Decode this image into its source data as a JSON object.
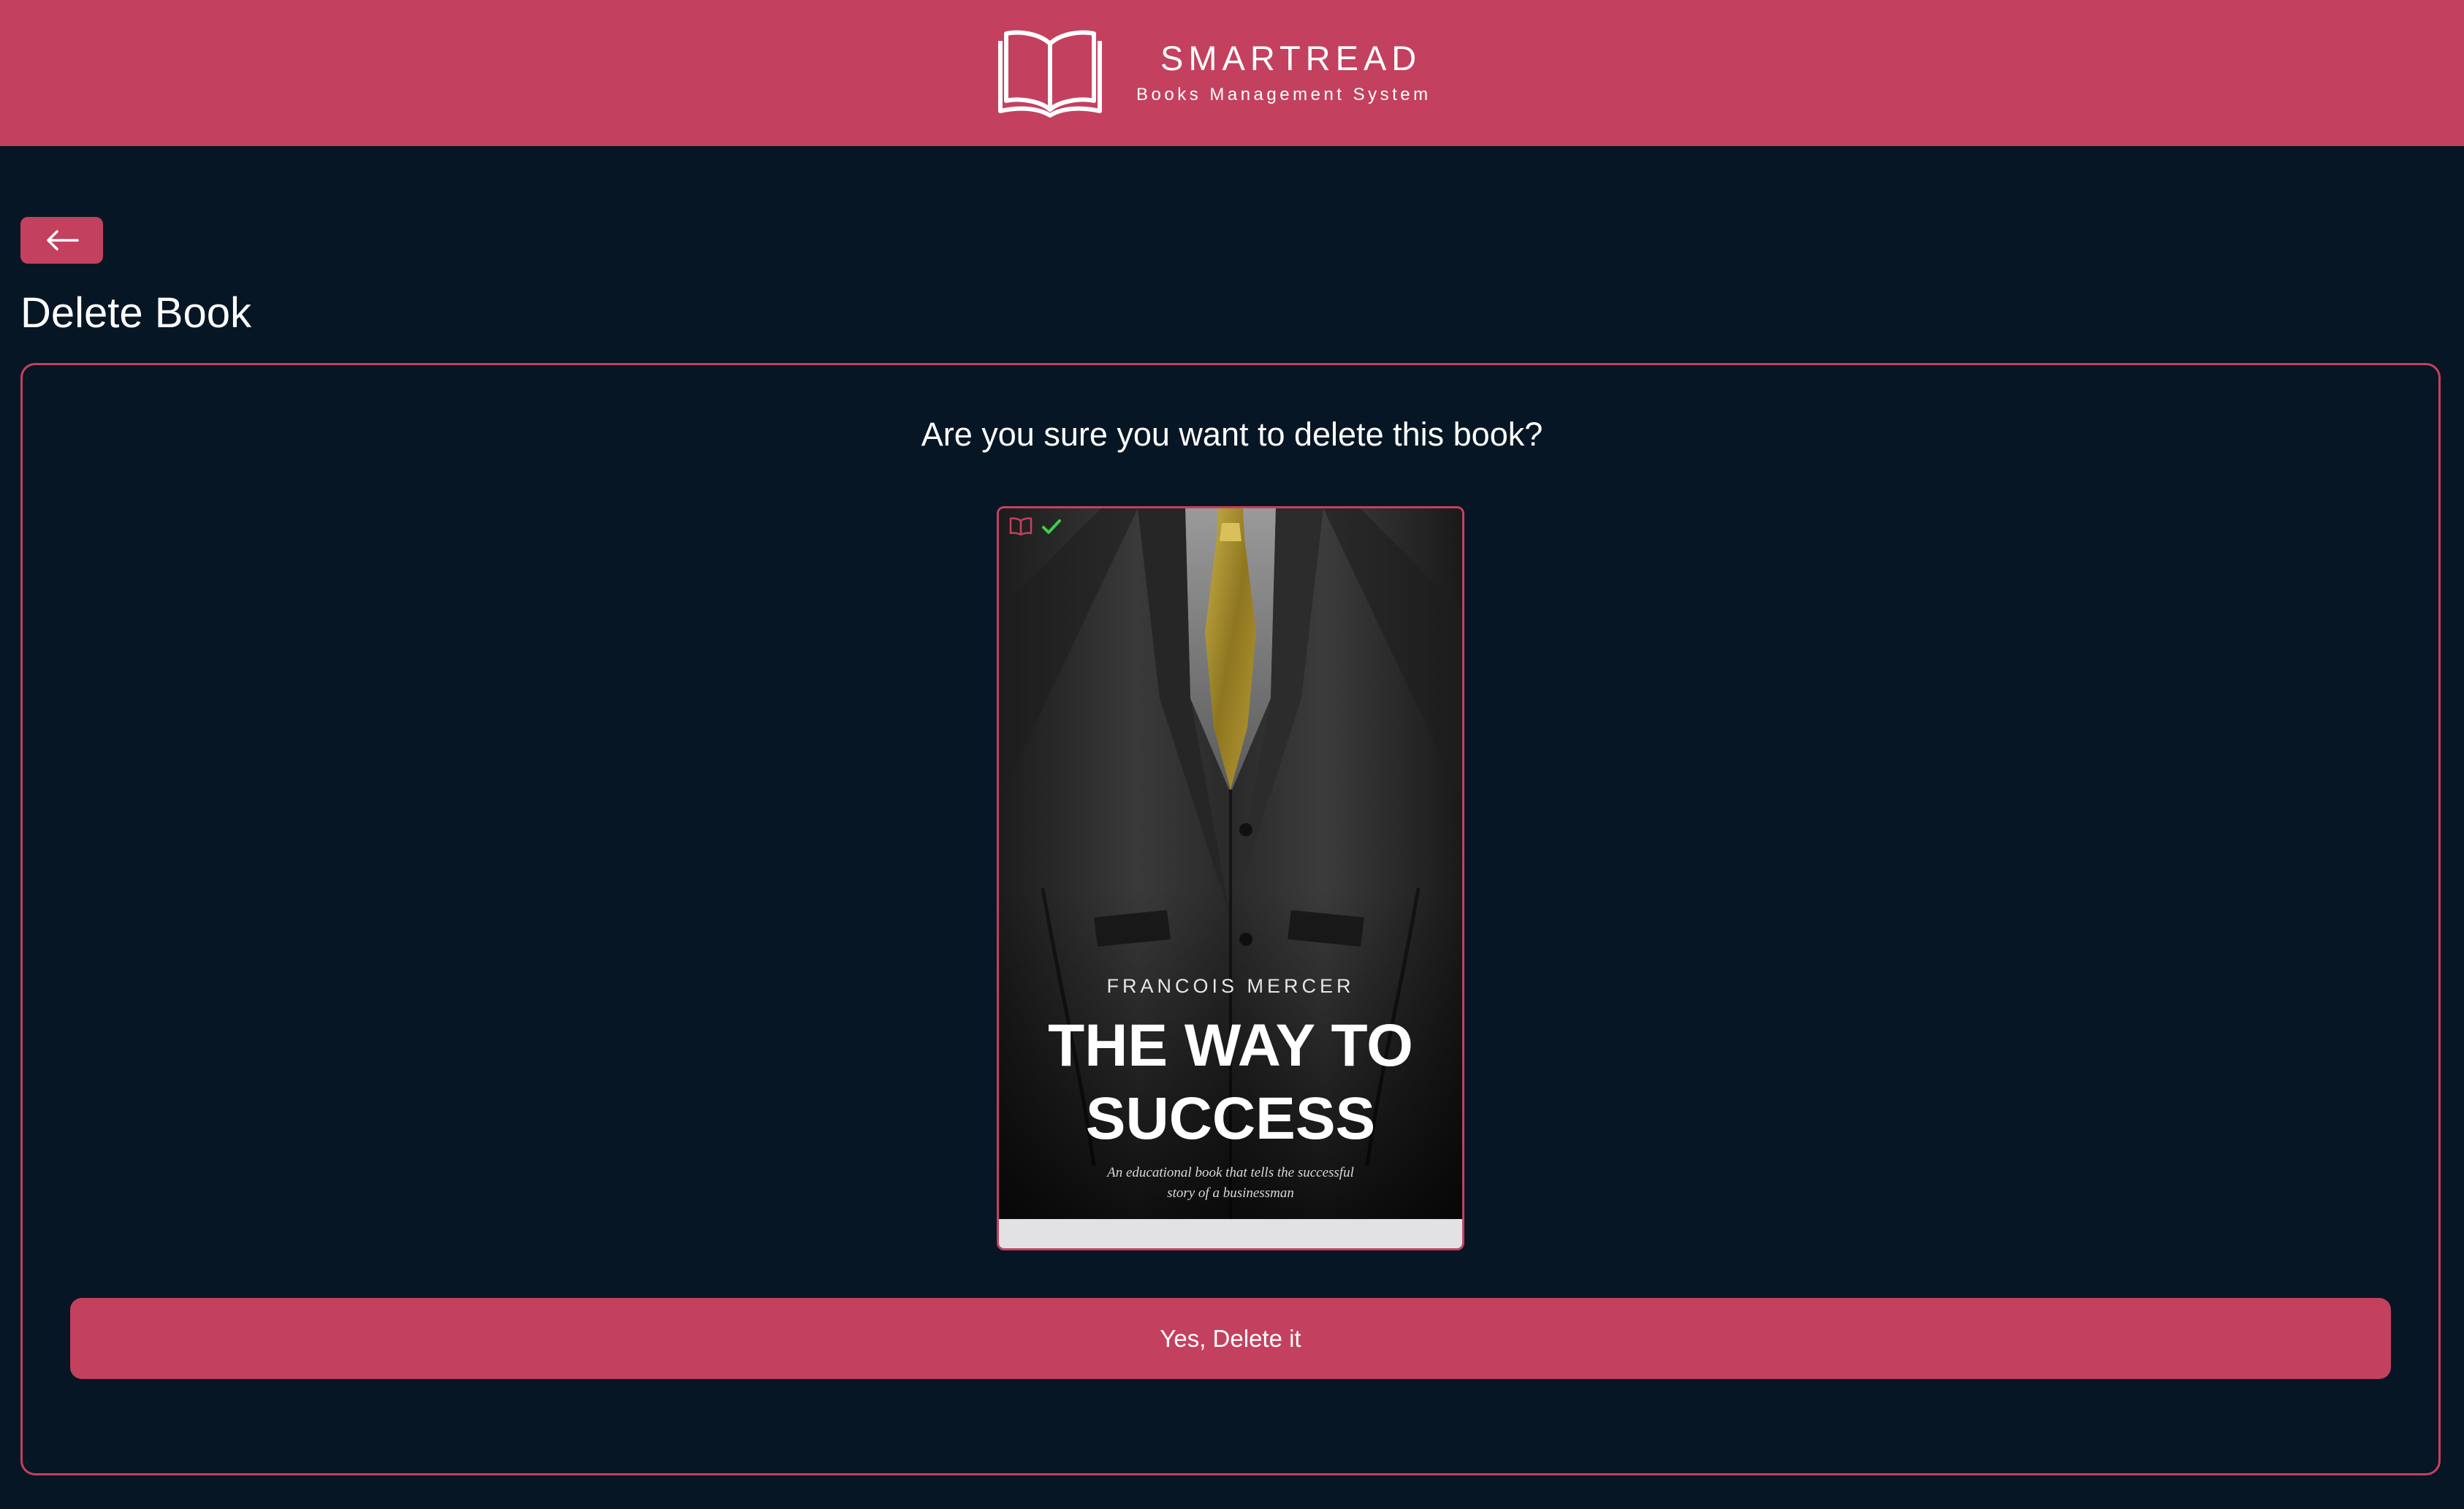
{
  "header": {
    "brand_name": "SMARTREAD",
    "brand_tagline": "Books Management System",
    "logo_icon": "open-book-icon"
  },
  "back_button": {
    "icon": "arrow-left-icon"
  },
  "page": {
    "title": "Delete Book",
    "question": "Are you sure you want to delete this book?"
  },
  "book": {
    "author": "FRANCOIS MERCER",
    "title": "THE WAY TO SUCCESS",
    "subtitle": "An educational book that tells the successful story of a businessman",
    "status_icons": [
      "open-book-icon",
      "checkmark-icon"
    ]
  },
  "actions": {
    "confirm_label": "Yes, Delete it"
  },
  "colors": {
    "accent": "#c4405f",
    "background": "#061624",
    "check": "#3ecf4c"
  }
}
